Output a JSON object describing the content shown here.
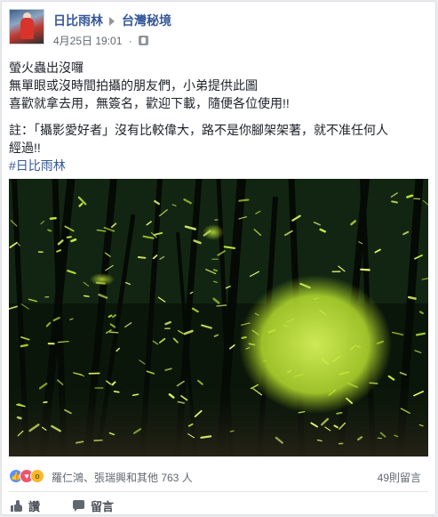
{
  "post": {
    "author": "日比雨林",
    "group": "台灣秘境",
    "date": "4月25日",
    "time": "19:01",
    "audience_icon": "group-audience-icon"
  },
  "body": {
    "line1": "螢火蟲出沒囉",
    "line2": "無單眼或沒時間拍攝的朋友們，小弟提供此圖",
    "line3": "喜歡就拿去用，無簽名，歡迎下載，隨便各位使用!!",
    "note1": "註：「攝影愛好者」沒有比較偉大，路不是你腳架架著，就不准任何人",
    "note2": "經過!!",
    "hashtag": "#日比雨林"
  },
  "photo": {
    "subject": "fireflies-in-bamboo-forest",
    "colors": {
      "glow": "#c8f03a",
      "bright": "#e8ff70",
      "dark": "#0b160a"
    }
  },
  "reactions": {
    "names": "羅仁鴻、張瑞興和其他 763 人",
    "comments": "49則留言",
    "icons": [
      "like-reaction-icon",
      "love-reaction-icon",
      "wow-reaction-icon"
    ]
  },
  "actions": {
    "like_label": "讚",
    "comment_label": "留言"
  },
  "colors": {
    "link": "#365899",
    "meta": "#616770",
    "text": "#1d2129"
  }
}
